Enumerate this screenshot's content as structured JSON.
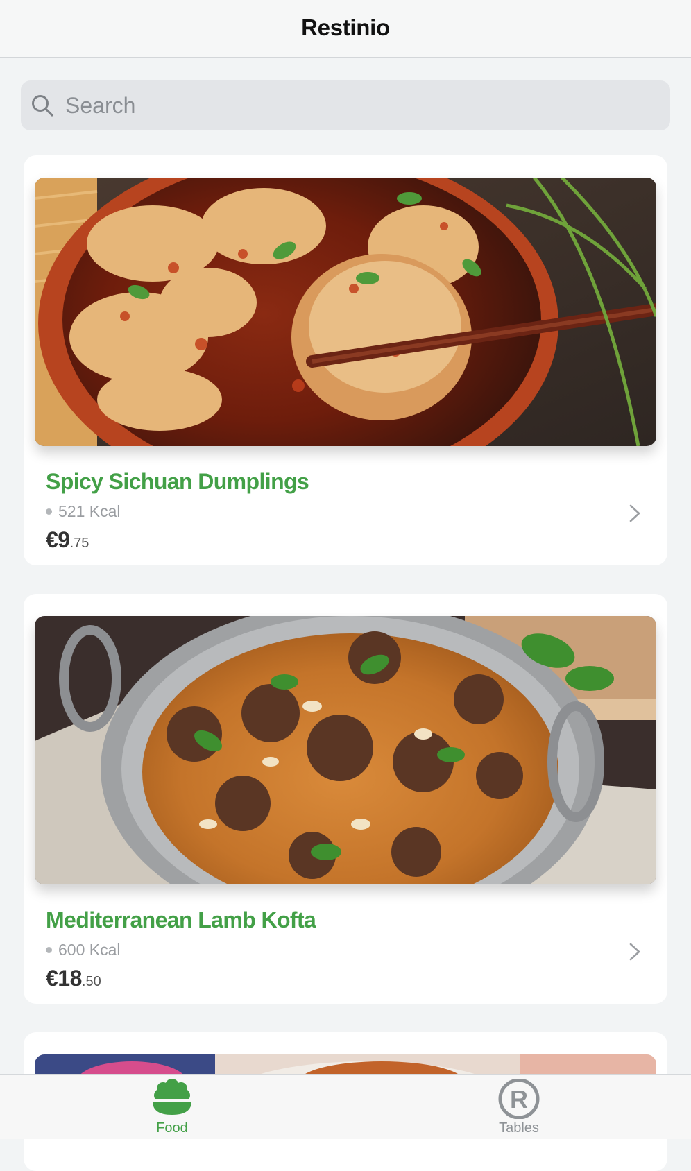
{
  "app": {
    "title": "Restinio"
  },
  "search": {
    "placeholder": "Search",
    "value": ""
  },
  "dishes": [
    {
      "name": "Spicy Sichuan Dumplings",
      "kcal": "521 Kcal",
      "price_main": "€9",
      "price_cents": ".75",
      "photo_icon": "dumplings-photo"
    },
    {
      "name": "Mediterranean Lamb Kofta",
      "kcal": "600 Kcal",
      "price_main": "€18",
      "price_cents": ".50",
      "photo_icon": "lamb-kofta-photo"
    },
    {
      "name": "",
      "photo_icon": "dish-photo"
    }
  ],
  "tabs": [
    {
      "label": "Food",
      "icon": "food-bowl-icon",
      "active": true
    },
    {
      "label": "Tables",
      "icon": "registered-r-icon",
      "active": false
    }
  ],
  "colors": {
    "accent": "#43a047",
    "background": "#f2f4f5",
    "card": "#ffffff",
    "muted_text": "#9a9da1"
  }
}
